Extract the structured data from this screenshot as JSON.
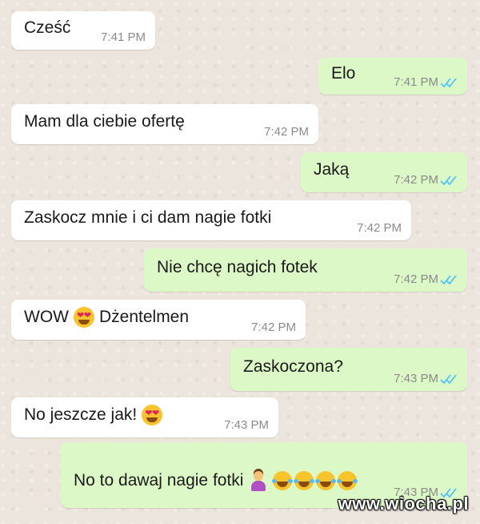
{
  "messages": [
    {
      "direction": "in",
      "text": "Cześć",
      "time": "7:41 PM"
    },
    {
      "direction": "out",
      "text": "Elo",
      "time": "7:41 PM",
      "read": true
    },
    {
      "direction": "in",
      "text": "Mam dla ciebie ofertę",
      "time": "7:42 PM"
    },
    {
      "direction": "out",
      "text": "Jaką",
      "time": "7:42 PM",
      "read": true
    },
    {
      "direction": "in",
      "text": "Zaskocz mnie i ci dam nagie fotki",
      "time": "7:42 PM"
    },
    {
      "direction": "out",
      "text": "Nie chcę nagich fotek",
      "time": "7:42 PM",
      "read": true
    },
    {
      "direction": "in",
      "text_before": "WOW",
      "emoji": "heart-eyes-emoji",
      "text_after": "Dżentelmen",
      "time": "7:42 PM"
    },
    {
      "direction": "out",
      "text": "Zaskoczona?",
      "time": "7:43 PM",
      "read": true
    },
    {
      "direction": "in",
      "text": "No jeszcze jak!",
      "emoji": "heart-eyes-emoji",
      "time": "7:43 PM"
    },
    {
      "direction": "out",
      "text": "No to dawaj nagie fotki",
      "emojis": [
        "person-shrugging-emoji",
        "tears-of-joy-emoji",
        "tears-of-joy-emoji",
        "tears-of-joy-emoji",
        "tears-of-joy-emoji"
      ],
      "time": "7:43 PM",
      "read": true
    }
  ],
  "colors": {
    "background": "#ece5dd",
    "incoming_bubble": "#ffffff",
    "outgoing_bubble": "#dcf8c6",
    "read_ticks": "#4fc3f7",
    "time_text": "#8a8a8a"
  },
  "watermark": "www.wiocha.pl"
}
